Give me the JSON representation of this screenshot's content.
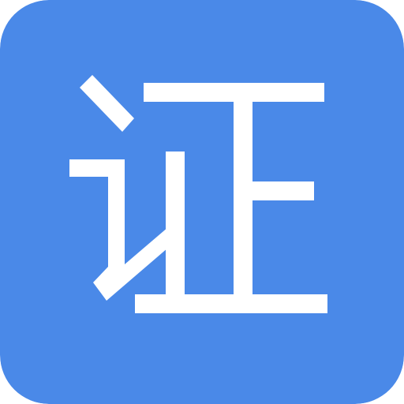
{
  "icon": {
    "glyph": "证",
    "glyph_icon": "zheng-character-icon",
    "colors": {
      "background": "#4A89E8",
      "glyph": "#FFFFFF"
    }
  }
}
